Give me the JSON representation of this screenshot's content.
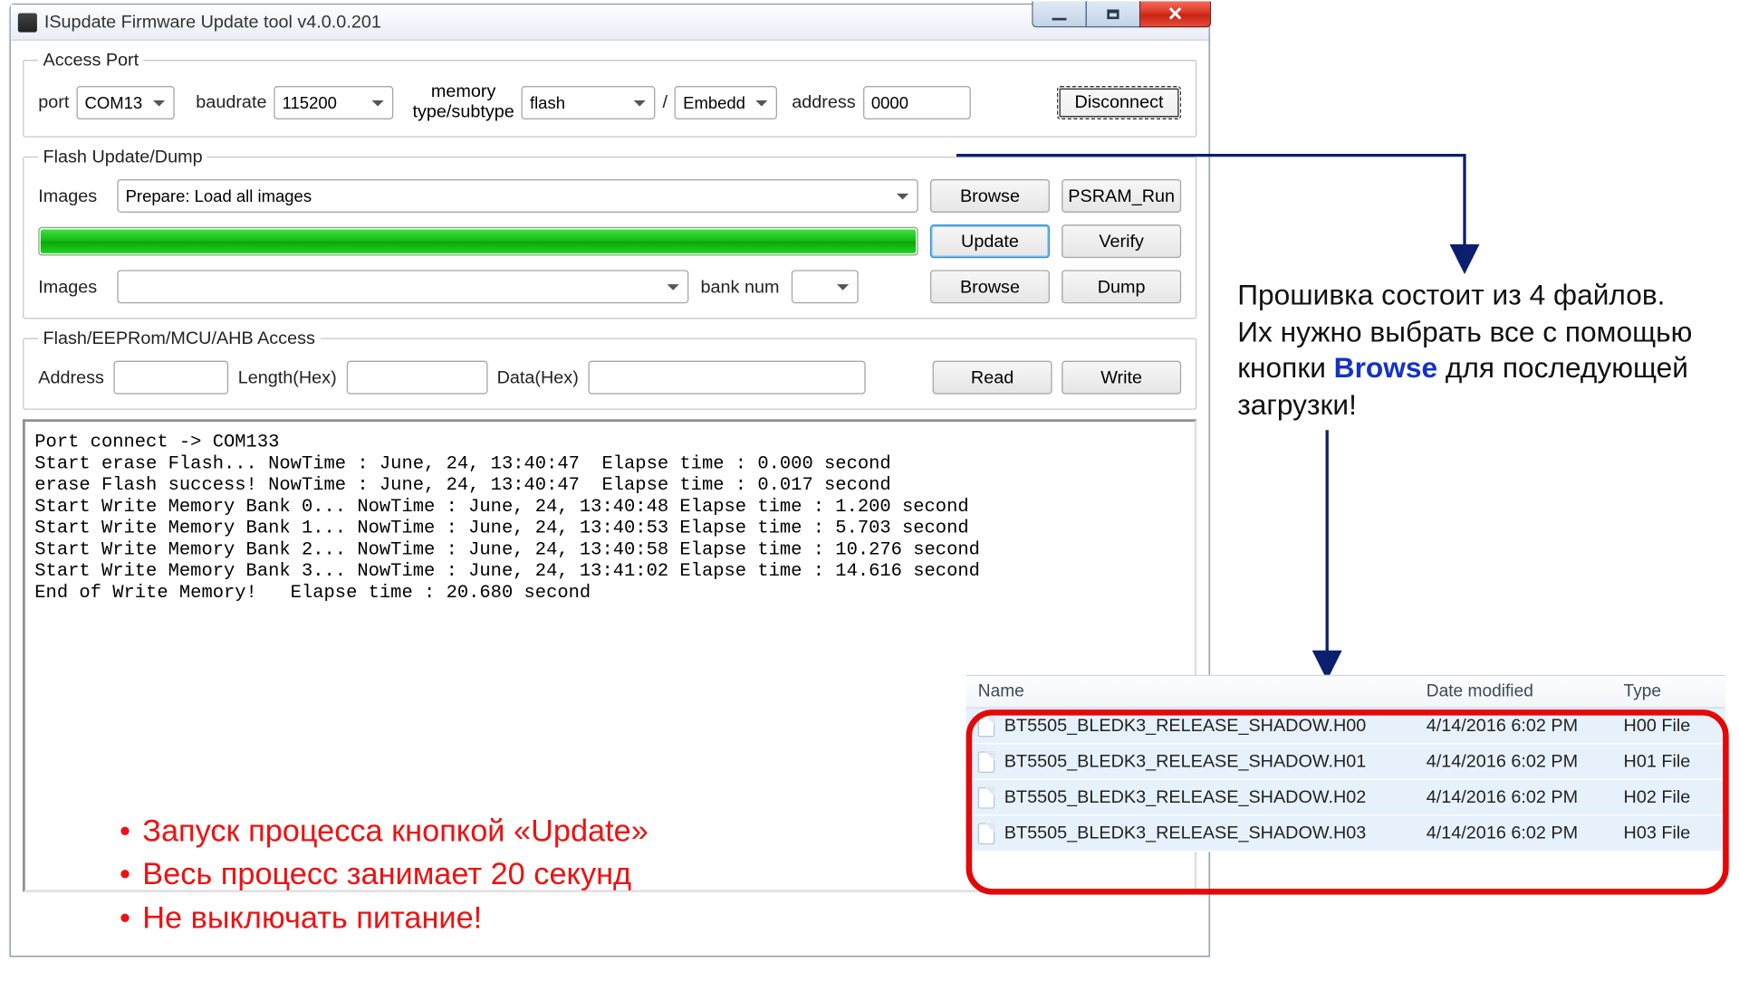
{
  "window": {
    "title": "ISupdate Firmware Update tool  v4.0.0.201"
  },
  "access_port": {
    "legend": "Access Port",
    "port_label": "port",
    "port_value": "COM13",
    "baudrate_label": "baudrate",
    "baudrate_value": "115200",
    "memory_label_line1": "memory",
    "memory_label_line2": "type/subtype",
    "memtype_value": "flash",
    "memsub_value": "Embedd",
    "slash": " /",
    "address_label": "address",
    "address_value": "0000",
    "disconnect_label": "Disconnect"
  },
  "flash_update": {
    "legend": "Flash Update/Dump",
    "images1_label": "Images",
    "images1_value": "Prepare: Load all images",
    "browse1_label": "Browse",
    "psram_label": "PSRAM_Run",
    "update_label": "Update",
    "verify_label": "Verify",
    "images2_label": "Images",
    "images2_value": "",
    "banknum_label": "bank num",
    "banknum_value": "",
    "browse2_label": "Browse",
    "dump_label": "Dump"
  },
  "flash_access": {
    "legend": "Flash/EEPRom/MCU/AHB Access",
    "address_label": "Address",
    "address_value": "",
    "length_label": "Length(Hex)",
    "length_value": "",
    "data_label": "Data(Hex)",
    "data_value": "",
    "read_label": "Read",
    "write_label": "Write"
  },
  "log_text": "Port connect -> COM133\nStart erase Flash... NowTime : June, 24, 13:40:47  Elapse time : 0.000 second\nerase Flash success! NowTime : June, 24, 13:40:47  Elapse time : 0.017 second\nStart Write Memory Bank 0... NowTime : June, 24, 13:40:48 Elapse time : 1.200 second\nStart Write Memory Bank 1... NowTime : June, 24, 13:40:53 Elapse time : 5.703 second\nStart Write Memory Bank 2... NowTime : June, 24, 13:40:58 Elapse time : 10.276 second\nStart Write Memory Bank 3... NowTime : June, 24, 13:41:02 Elapse time : 14.616 second\nEnd of Write Memory!   Elapse time : 20.680 second",
  "red_notes": {
    "n1": "Запуск процесса кнопкой «Update»",
    "n2": "Весь процесс занимает 20 секунд",
    "n3": "Не выключать питание!"
  },
  "annotation": {
    "line1": "Прошивка состоит из 4 файлов.",
    "line2_a": "Их нужно выбрать все с помощью кнопки ",
    "line2_kw": "Browse",
    "line2_b": " для последующей загрузки!"
  },
  "filelist": {
    "headers": {
      "name": "Name",
      "date": "Date modified",
      "type": "Type"
    },
    "rows": [
      {
        "name": "BT5505_BLEDK3_RELEASE_SHADOW.H00",
        "date": "4/14/2016 6:02 PM",
        "type": "H00 File"
      },
      {
        "name": "BT5505_BLEDK3_RELEASE_SHADOW.H01",
        "date": "4/14/2016 6:02 PM",
        "type": "H01 File"
      },
      {
        "name": "BT5505_BLEDK3_RELEASE_SHADOW.H02",
        "date": "4/14/2016 6:02 PM",
        "type": "H02 File"
      },
      {
        "name": "BT5505_BLEDK3_RELEASE_SHADOW.H03",
        "date": "4/14/2016 6:02 PM",
        "type": "H03 File"
      }
    ]
  }
}
